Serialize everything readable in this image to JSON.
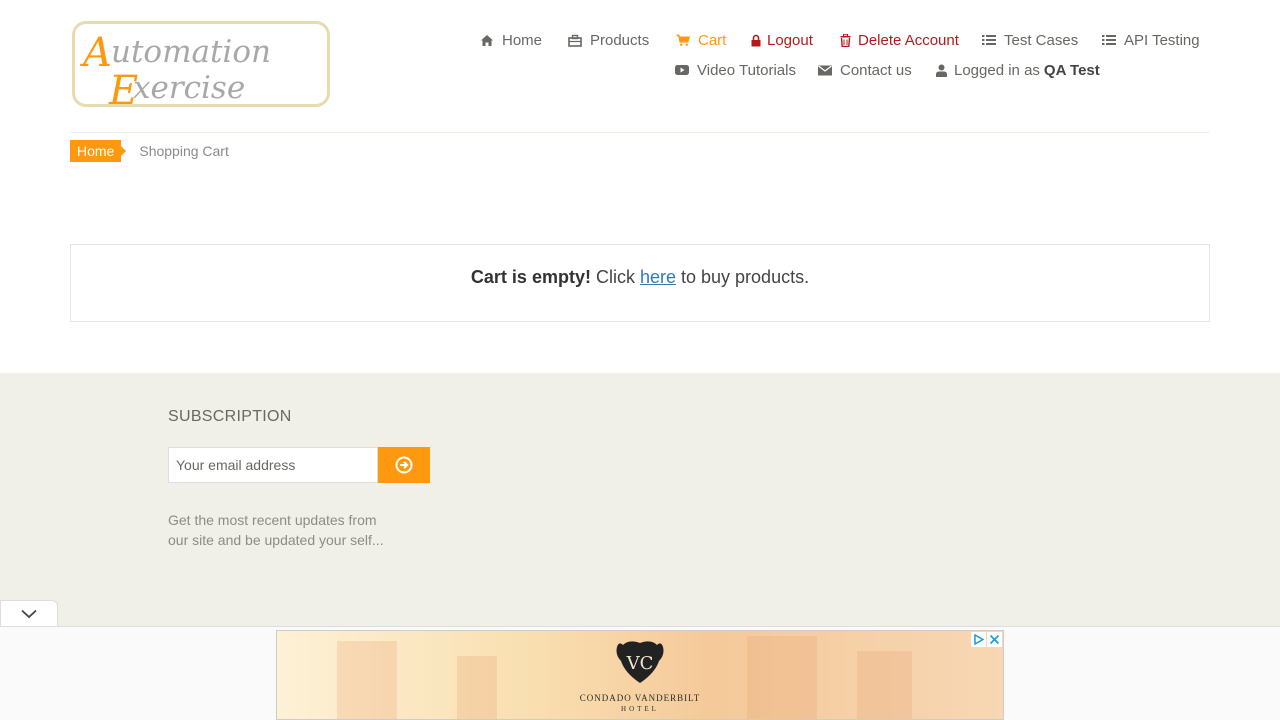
{
  "logo": {
    "line1": "Automation",
    "line2": "Exercise"
  },
  "nav": {
    "home": "Home",
    "products": "Products",
    "cart": "Cart",
    "logout": "Logout",
    "delete_account": "Delete Account",
    "test_cases": "Test Cases",
    "api_testing": "API Testing",
    "video_tutorials": "Video Tutorials",
    "contact_us": "Contact us",
    "logged_in_prefix": "Logged in as",
    "username": "QA Test"
  },
  "breadcrumb": {
    "home": "Home",
    "current": "Shopping Cart"
  },
  "cart": {
    "empty_bold": "Cart is empty!",
    "click_text": " Click ",
    "link_text": "here",
    "after_link": " to buy products."
  },
  "footer": {
    "subscription_title": "SUBSCRIPTION",
    "email_placeholder": "Your email address",
    "description": "Get the most recent updates from our site and be updated your self..."
  },
  "ad": {
    "brand": "CONDADO VANDERBILT",
    "subbrand": "HOTEL"
  },
  "colors": {
    "accent": "#fe980f",
    "danger": "#b31b1b",
    "link": "#337ab7",
    "footer_bg": "#f0efe8"
  }
}
